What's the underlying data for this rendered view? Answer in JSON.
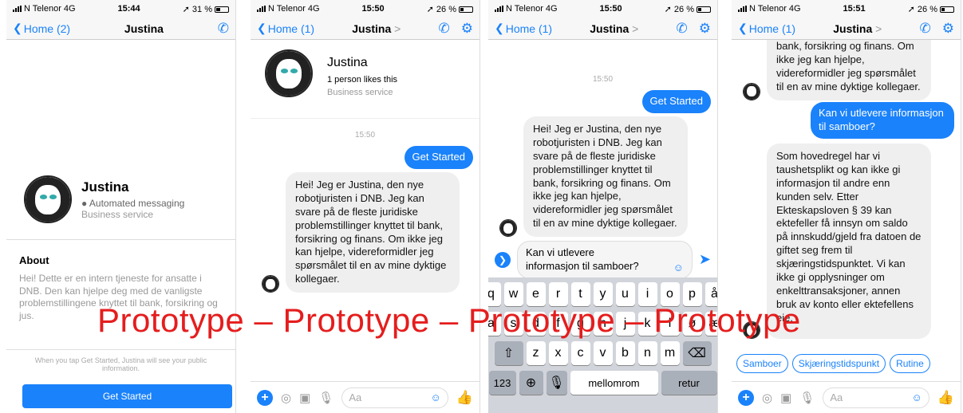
{
  "screens": [
    {
      "status": {
        "carrier": "N Telenor",
        "network": "4G",
        "time": "15:44",
        "battery": "31 %",
        "battery_level": 0.31
      },
      "nav": {
        "back_label": "Home (2)",
        "title": "Justina"
      },
      "profile": {
        "name": "Justina",
        "automated_label": "Automated messaging",
        "category": "Business service"
      },
      "about": {
        "heading": "About",
        "text": "Hei! Dette er en intern tjeneste for ansatte i DNB. Den kan hjelpe deg med de vanligste problemstillingene knyttet til bank, forsikring og jus."
      },
      "notice": "When you tap Get Started, Justina will see your public information.",
      "get_started_button": "Get Started"
    },
    {
      "status": {
        "carrier": "N Telenor",
        "network": "4G",
        "time": "15:50",
        "battery": "26 %",
        "battery_level": 0.26
      },
      "nav": {
        "back_label": "Home (1)",
        "title": "Justina",
        "title_chevron": ">"
      },
      "profile": {
        "name": "Justina",
        "likes": "1 person likes this",
        "category": "Business service"
      },
      "timestamp": "15:50",
      "outgoing": "Get Started",
      "incoming": "Hei! Jeg er Justina, den nye robotjuristen i DNB. Jeg kan svare på de fleste juridiske problemstillinger knyttet til bank, forsikring og finans. Om ikke jeg kan hjelpe, videreformidler jeg spørsmålet til en av mine dyktige kollegaer.",
      "composer_placeholder": "Aa"
    },
    {
      "status": {
        "carrier": "N Telenor",
        "network": "4G",
        "time": "15:50",
        "battery": "26 %",
        "battery_level": 0.26
      },
      "nav": {
        "back_label": "Home (1)",
        "title": "Justina",
        "title_chevron": ">"
      },
      "timestamp": "15:50",
      "outgoing": "Get Started",
      "incoming": "Hei! Jeg er Justina, den nye robotjuristen i DNB. Jeg kan svare på de fleste juridiske problemstillinger knyttet til bank, forsikring og finans. Om ikke jeg kan hjelpe, videreformidler jeg spørsmålet til en av mine dyktige kollegaer.",
      "draft": "Kan vi utlevere informasjon til samboer?",
      "keyboard": {
        "row1": [
          "q",
          "w",
          "e",
          "r",
          "t",
          "y",
          "u",
          "i",
          "o",
          "p",
          "å"
        ],
        "row2": [
          "a",
          "s",
          "d",
          "f",
          "g",
          "h",
          "j",
          "k",
          "l",
          "ø",
          "æ"
        ],
        "row3": [
          "z",
          "x",
          "c",
          "v",
          "b",
          "n",
          "m"
        ],
        "numbers_key": "123",
        "space_key": "mellomrom",
        "return_key": "retur"
      }
    },
    {
      "status": {
        "carrier": "N Telenor",
        "network": "4G",
        "time": "15:51",
        "battery": "26 %",
        "battery_level": 0.26
      },
      "nav": {
        "back_label": "Home (1)",
        "title": "Justina",
        "title_chevron": ">"
      },
      "incoming_top": "bank, forsikring og finans. Om ikke jeg kan hjelpe, videreformidler jeg spørsmålet til en av mine dyktige kollegaer.",
      "outgoing": "Kan vi utlevere informasjon til samboer?",
      "incoming": "Som hovedregel har vi taushetsplikt og kan ikke gi informasjon til andre enn kunden selv. Etter Ekteskapsloven § 39 kan ektefeller få innsyn om saldo på innskudd/gjeld fra datoen de giftet seg frem til skjæringstidspunktet. Vi kan ikke gi opplysninger om enkelttransaksjoner, annen bruk av konto eller ektefellens eie.",
      "chips": [
        "Samboer",
        "Skjæringstidspunkt",
        "Rutine"
      ],
      "composer_placeholder": "Aa"
    }
  ],
  "watermark": "Prototype – Prototype – Prototype – Prototype",
  "colors": {
    "accent": "#1a82fb",
    "watermark": "#e51d1d"
  }
}
